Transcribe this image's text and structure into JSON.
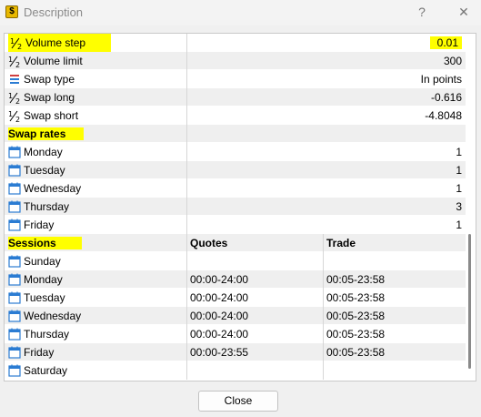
{
  "window": {
    "title": "Description",
    "help_label": "?",
    "close_label": "✕",
    "app_icon_label": "$"
  },
  "properties": [
    {
      "name": "Volume step",
      "value": "0.01",
      "icon": "half-fraction-icon"
    },
    {
      "name": "Volume limit",
      "value": "300",
      "icon": "half-fraction-icon"
    },
    {
      "name": "Swap type",
      "value": "In points",
      "icon": "list-icon"
    },
    {
      "name": "Swap long",
      "value": "-0.616",
      "icon": "half-fraction-icon"
    },
    {
      "name": "Swap short",
      "value": "-4.8048",
      "icon": "half-fraction-icon"
    }
  ],
  "swap_rates": {
    "header": "Swap rates",
    "rows": [
      {
        "day": "Monday",
        "value": "1"
      },
      {
        "day": "Tuesday",
        "value": "1"
      },
      {
        "day": "Wednesday",
        "value": "1"
      },
      {
        "day": "Thursday",
        "value": "3"
      },
      {
        "day": "Friday",
        "value": "1"
      }
    ]
  },
  "sessions": {
    "header": "Sessions",
    "col_quotes": "Quotes",
    "col_trade": "Trade",
    "rows": [
      {
        "day": "Sunday",
        "quotes": "",
        "trade": ""
      },
      {
        "day": "Monday",
        "quotes": "00:00-24:00",
        "trade": "00:05-23:58"
      },
      {
        "day": "Tuesday",
        "quotes": "00:00-24:00",
        "trade": "00:05-23:58"
      },
      {
        "day": "Wednesday",
        "quotes": "00:00-24:00",
        "trade": "00:05-23:58"
      },
      {
        "day": "Thursday",
        "quotes": "00:00-24:00",
        "trade": "00:05-23:58"
      },
      {
        "day": "Friday",
        "quotes": "00:00-23:55",
        "trade": "00:05-23:58"
      },
      {
        "day": "Saturday",
        "quotes": "",
        "trade": ""
      }
    ]
  },
  "footer": {
    "close_button": "Close"
  },
  "colors": {
    "highlight": "#ffff00",
    "calendar_icon": "#2b7cd3",
    "row_alt": "#efefef"
  }
}
